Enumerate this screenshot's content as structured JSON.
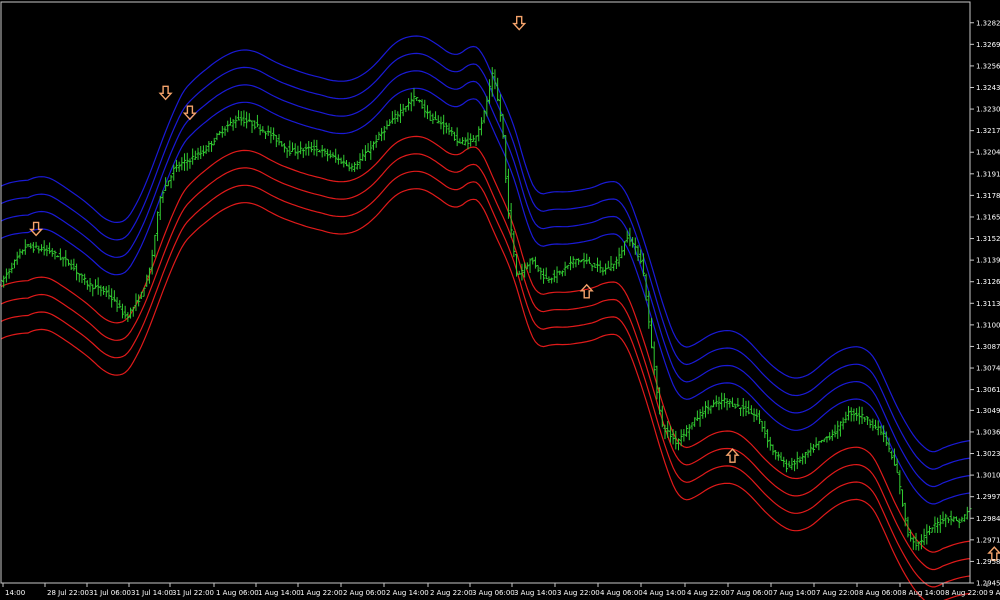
{
  "colors": {
    "background": "#000000",
    "frame": "#c8c8c8",
    "bar": "#32cd32",
    "upper_band": "#1a1ad6",
    "lower_band": "#e01a1a",
    "arrow": "#f4a36b"
  },
  "chart_data": {
    "type": "line",
    "title": "",
    "xlabel": "",
    "ylabel": "",
    "ylim": [
      1.2945,
      1.3295
    ],
    "y_ticks": [
      "1.32825",
      "1.32695",
      "1.32565",
      "1.32435",
      "1.32305",
      "1.32175",
      "1.32045",
      "1.31915",
      "1.31785",
      "1.31655",
      "1.31525",
      "1.31395",
      "1.31265",
      "1.31135",
      "1.31005",
      "1.30875",
      "1.30745",
      "1.30615",
      "1.30490",
      "1.30360",
      "1.30230",
      "1.30100",
      "1.29970",
      "1.29840",
      "1.29710",
      "1.29580",
      "1.29450"
    ],
    "x_ticks": [
      "14:00",
      "28 Jul 22:00",
      "31 Jul 06:00",
      "31 Jul 14:00",
      "31 Jul 22:00",
      "1 Aug 06:00",
      "1 Aug 14:00",
      "1 Aug 22:00",
      "2 Aug 06:00",
      "2 Aug 14:00",
      "2 Aug 22:00",
      "3 Aug 06:00",
      "3 Aug 14:00",
      "3 Aug 22:00",
      "4 Aug 06:00",
      "4 Aug 14:00",
      "4 Aug 22:00",
      "7 Aug 06:00",
      "7 Aug 14:00",
      "7 Aug 22:00",
      "8 Aug 06:00",
      "8 Aug 14:00",
      "8 Aug 22:00",
      "9 Aug 06:00"
    ],
    "grid": false,
    "legend": "none",
    "price_anchors": [
      [
        0,
        1.3126
      ],
      [
        5,
        1.3148
      ],
      [
        10,
        1.3145
      ],
      [
        14,
        1.3138
      ],
      [
        18,
        1.3125
      ],
      [
        22,
        1.312
      ],
      [
        26,
        1.3105
      ],
      [
        29,
        1.3118
      ],
      [
        31,
        1.3135
      ],
      [
        33,
        1.3178
      ],
      [
        36,
        1.3195
      ],
      [
        39,
        1.32
      ],
      [
        42,
        1.3205
      ],
      [
        46,
        1.3218
      ],
      [
        49,
        1.3225
      ],
      [
        52,
        1.3222
      ],
      [
        56,
        1.3215
      ],
      [
        60,
        1.3205
      ],
      [
        65,
        1.3207
      ],
      [
        70,
        1.32
      ],
      [
        73,
        1.3195
      ],
      [
        76,
        1.3205
      ],
      [
        80,
        1.322
      ],
      [
        83,
        1.323
      ],
      [
        86,
        1.3238
      ],
      [
        89,
        1.3225
      ],
      [
        92,
        1.3221
      ],
      [
        95,
        1.321
      ],
      [
        98,
        1.3212
      ],
      [
        100,
        1.3225
      ],
      [
        102,
        1.3252
      ],
      [
        104,
        1.322
      ],
      [
        105,
        1.3175
      ],
      [
        107,
        1.313
      ],
      [
        110,
        1.314
      ],
      [
        113,
        1.3128
      ],
      [
        116,
        1.3132
      ],
      [
        119,
        1.314
      ],
      [
        122,
        1.3138
      ],
      [
        125,
        1.3133
      ],
      [
        128,
        1.314
      ],
      [
        130,
        1.3155
      ],
      [
        133,
        1.3138
      ],
      [
        135,
        1.3085
      ],
      [
        137,
        1.304
      ],
      [
        140,
        1.303
      ],
      [
        143,
        1.304
      ],
      [
        146,
        1.305
      ],
      [
        150,
        1.3055
      ],
      [
        154,
        1.305
      ],
      [
        157,
        1.3045
      ],
      [
        160,
        1.3025
      ],
      [
        163,
        1.3015
      ],
      [
        166,
        1.302
      ],
      [
        170,
        1.303
      ],
      [
        173,
        1.3036
      ],
      [
        176,
        1.3048
      ],
      [
        179,
        1.3045
      ],
      [
        183,
        1.3035
      ],
      [
        186,
        1.301
      ],
      [
        188,
        1.2975
      ],
      [
        190,
        1.2968
      ],
      [
        193,
        1.2978
      ],
      [
        196,
        1.2985
      ],
      [
        199,
        1.2982
      ],
      [
        201,
        1.299
      ]
    ],
    "band_offsets_upper": [
      0.00145,
      0.0025,
      0.00355,
      0.0046
    ],
    "band_offsets_lower": [
      -0.00145,
      -0.0025,
      -0.00355,
      -0.0046
    ],
    "arrows": [
      {
        "direction": "down",
        "bar": 13,
        "price": 1.3158
      },
      {
        "direction": "down",
        "bar": 61,
        "price": 1.324
      },
      {
        "direction": "down",
        "bar": 70,
        "price": 1.3228
      },
      {
        "direction": "down",
        "bar": 192,
        "price": 1.3282
      },
      {
        "direction": "up",
        "bar": 217,
        "price": 1.3121
      },
      {
        "direction": "up",
        "bar": 271,
        "price": 1.3022
      },
      {
        "direction": "up",
        "bar": 368,
        "price": 1.2963
      }
    ]
  }
}
